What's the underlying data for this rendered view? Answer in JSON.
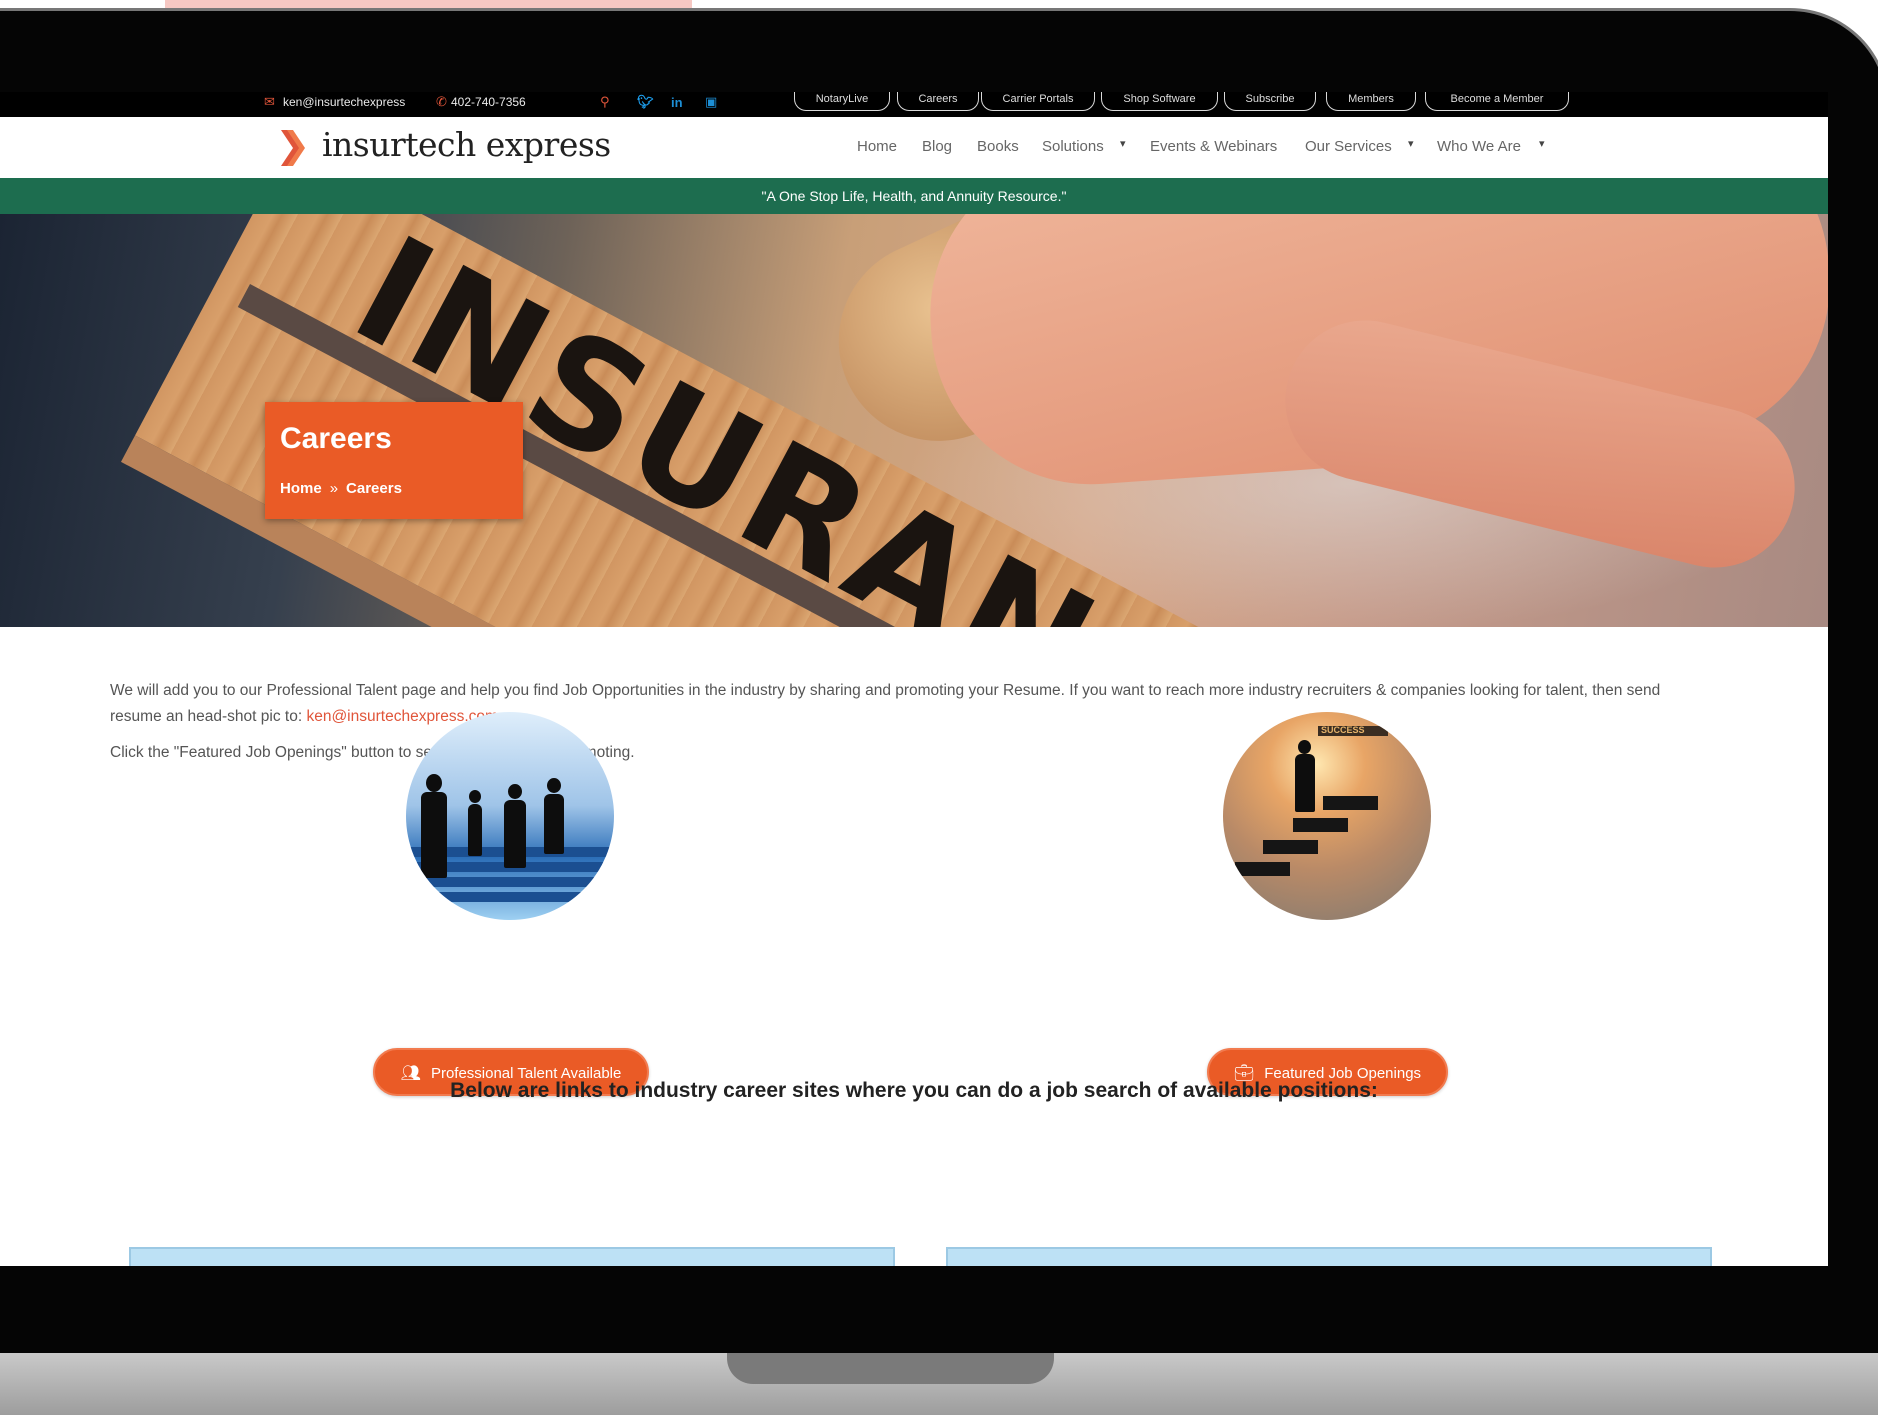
{
  "utility": {
    "email": "ken@insurtechexpress",
    "phone": "402-740-7356",
    "buttons": [
      "NotaryLive",
      "Careers",
      "Carrier Portals",
      "Shop Software",
      "Subscribe",
      "Members",
      "Become a Member"
    ]
  },
  "brand": {
    "name": "insurtech express",
    "accent": "#ea5b26",
    "green": "#1d6d4f"
  },
  "nav": {
    "items": [
      "Home",
      "Blog",
      "Books",
      "Solutions",
      "Events & Webinars",
      "Our Services",
      "Who We Are"
    ]
  },
  "tagline": "\"A One Stop Life, Health, and Annuity Resource.\"",
  "hero": {
    "word": "INSURAN",
    "title": "Careers",
    "crumb_home": "Home",
    "crumb_sep": "»",
    "crumb_current": "Careers"
  },
  "content": {
    "para1": "We will add you to our Professional Talent page and help you find Job Opportunities in the industry by sharing and promoting your Resume. If you want to reach more industry recruiters & companies looking for talent, then send resume an head-shot pic to: ",
    "email_link": "ken@insurtechexpress.com",
    "para2": "Click the \"Featured Job Openings\" button to see Hot Jobs we are promoting.",
    "btn_talent": "Professional Talent Available",
    "btn_jobs": "Featured Job Openings",
    "subhead": "Below are links to industry career sites where you can do a job search of available positions:",
    "sign_text": "SUCCESS"
  }
}
